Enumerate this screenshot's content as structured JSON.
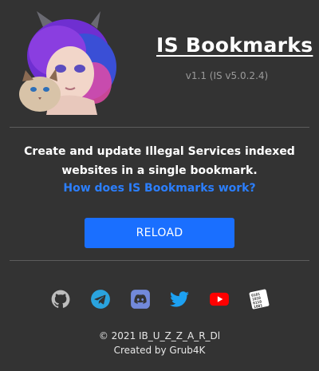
{
  "header": {
    "title": "IS Bookmarks",
    "version": "v1.1 (IS v5.0.2.4)"
  },
  "main": {
    "description": "Create and update Illegal Services indexed websites in a single bookmark.",
    "how_link": "How does IS Bookmarks work?",
    "reload_label": "RELOAD"
  },
  "socials": [
    {
      "icon": "github-icon",
      "color": "#bdbdbd"
    },
    {
      "icon": "telegram-icon",
      "color": "#2aa3de"
    },
    {
      "icon": "discord-icon",
      "color": "#7289da"
    },
    {
      "icon": "twitter-icon",
      "color": "#1da1f2"
    },
    {
      "icon": "youtube-icon",
      "color": "#ff0000"
    },
    {
      "icon": "binary-icon",
      "color": "#ffffff"
    }
  ],
  "footer": {
    "copyright": "© 2021 IB_U_Z_Z_A_R_Dl",
    "credits": "Created by Grub4K"
  },
  "colors": {
    "background": "#333333",
    "accent": "#1a6fff",
    "link": "#2b7fff"
  }
}
